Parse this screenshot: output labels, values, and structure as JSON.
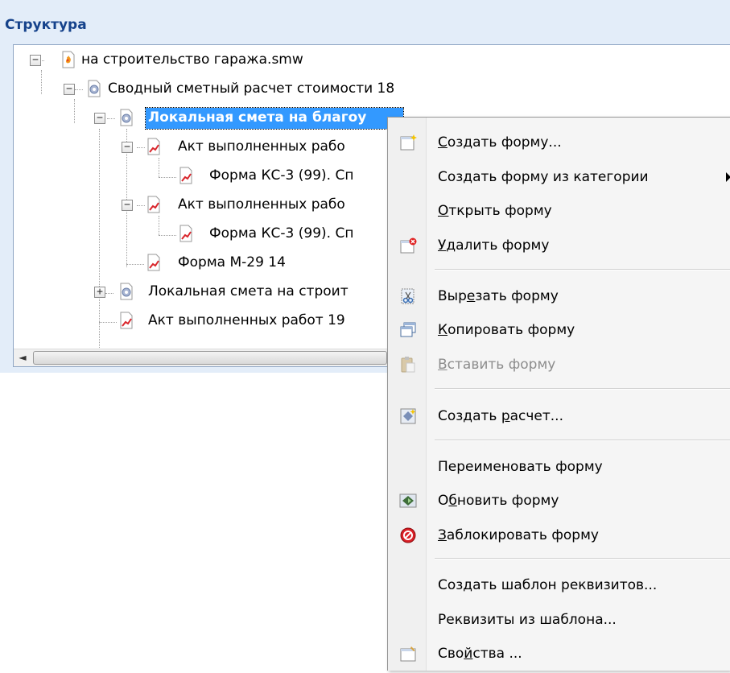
{
  "panel": {
    "title": "Структура"
  },
  "tree": {
    "nodes": [
      {
        "label": "на строительство гаража.smw",
        "icon": "document-flame-icon",
        "toggle": "−"
      },
      {
        "label": "Сводный сметный расчет стоимости 18",
        "icon": "gear-icon",
        "toggle": "−"
      },
      {
        "label": "Локальная смета на благоу",
        "icon": "gear-icon",
        "toggle": "−",
        "selected": true
      },
      {
        "label": "Акт выполненных рабо",
        "icon": "chart-doc-icon",
        "toggle": "−"
      },
      {
        "label": "Форма КС-3 (99). Сп",
        "icon": "chart-doc-icon"
      },
      {
        "label": "Акт выполненных рабо",
        "icon": "chart-doc-icon",
        "toggle": "−"
      },
      {
        "label": "Форма КС-3 (99). Сп",
        "icon": "chart-doc-icon"
      },
      {
        "label": "Форма М-29 14",
        "icon": "chart-doc-icon"
      },
      {
        "label": "Локальная смета на строит",
        "icon": "gear-icon",
        "toggle": "+"
      },
      {
        "label": "Акт выполненных работ 19",
        "icon": "chart-doc-icon"
      }
    ],
    "scroll_left": "◄"
  },
  "menu": {
    "items": [
      {
        "pre": "",
        "u": "С",
        "post": "оздать форму...",
        "icon": "new-form-icon"
      },
      {
        "pre": "Создать форму из категории",
        "u": "",
        "post": "",
        "submenu": true
      },
      {
        "pre": "",
        "u": "О",
        "post": "ткрыть форму"
      },
      {
        "pre": "",
        "u": "У",
        "post": "далить форму",
        "icon": "delete-form-icon"
      },
      {
        "pre": "Выр",
        "u": "е",
        "post": "зать форму",
        "icon": "cut-icon"
      },
      {
        "pre": "",
        "u": "К",
        "post": "опировать форму",
        "icon": "copy-icon"
      },
      {
        "pre": "",
        "u": "В",
        "post": "ставить форму",
        "icon": "paste-icon",
        "disabled": true
      },
      {
        "pre": "Создать ",
        "u": "р",
        "post": "асчет...",
        "icon": "create-calc-icon"
      },
      {
        "pre": "Переименовать форму",
        "u": "",
        "post": ""
      },
      {
        "pre": "О",
        "u": "б",
        "post": "новить форму",
        "icon": "refresh-icon"
      },
      {
        "pre": "",
        "u": "З",
        "post": "аблокировать форму",
        "icon": "block-icon"
      },
      {
        "pre": "Создать шаблон реквизитов...",
        "u": "",
        "post": ""
      },
      {
        "pre": "Реквизиты из шаблона...",
        "u": "",
        "post": ""
      },
      {
        "pre": "Сво",
        "u": "й",
        "post": "ства ...",
        "icon": "properties-icon"
      }
    ]
  },
  "colors": {
    "panel_bg": "#e3edf9",
    "header_text": "#15428b",
    "selection": "#3399ff",
    "menu_bg": "#f5f5f5"
  }
}
